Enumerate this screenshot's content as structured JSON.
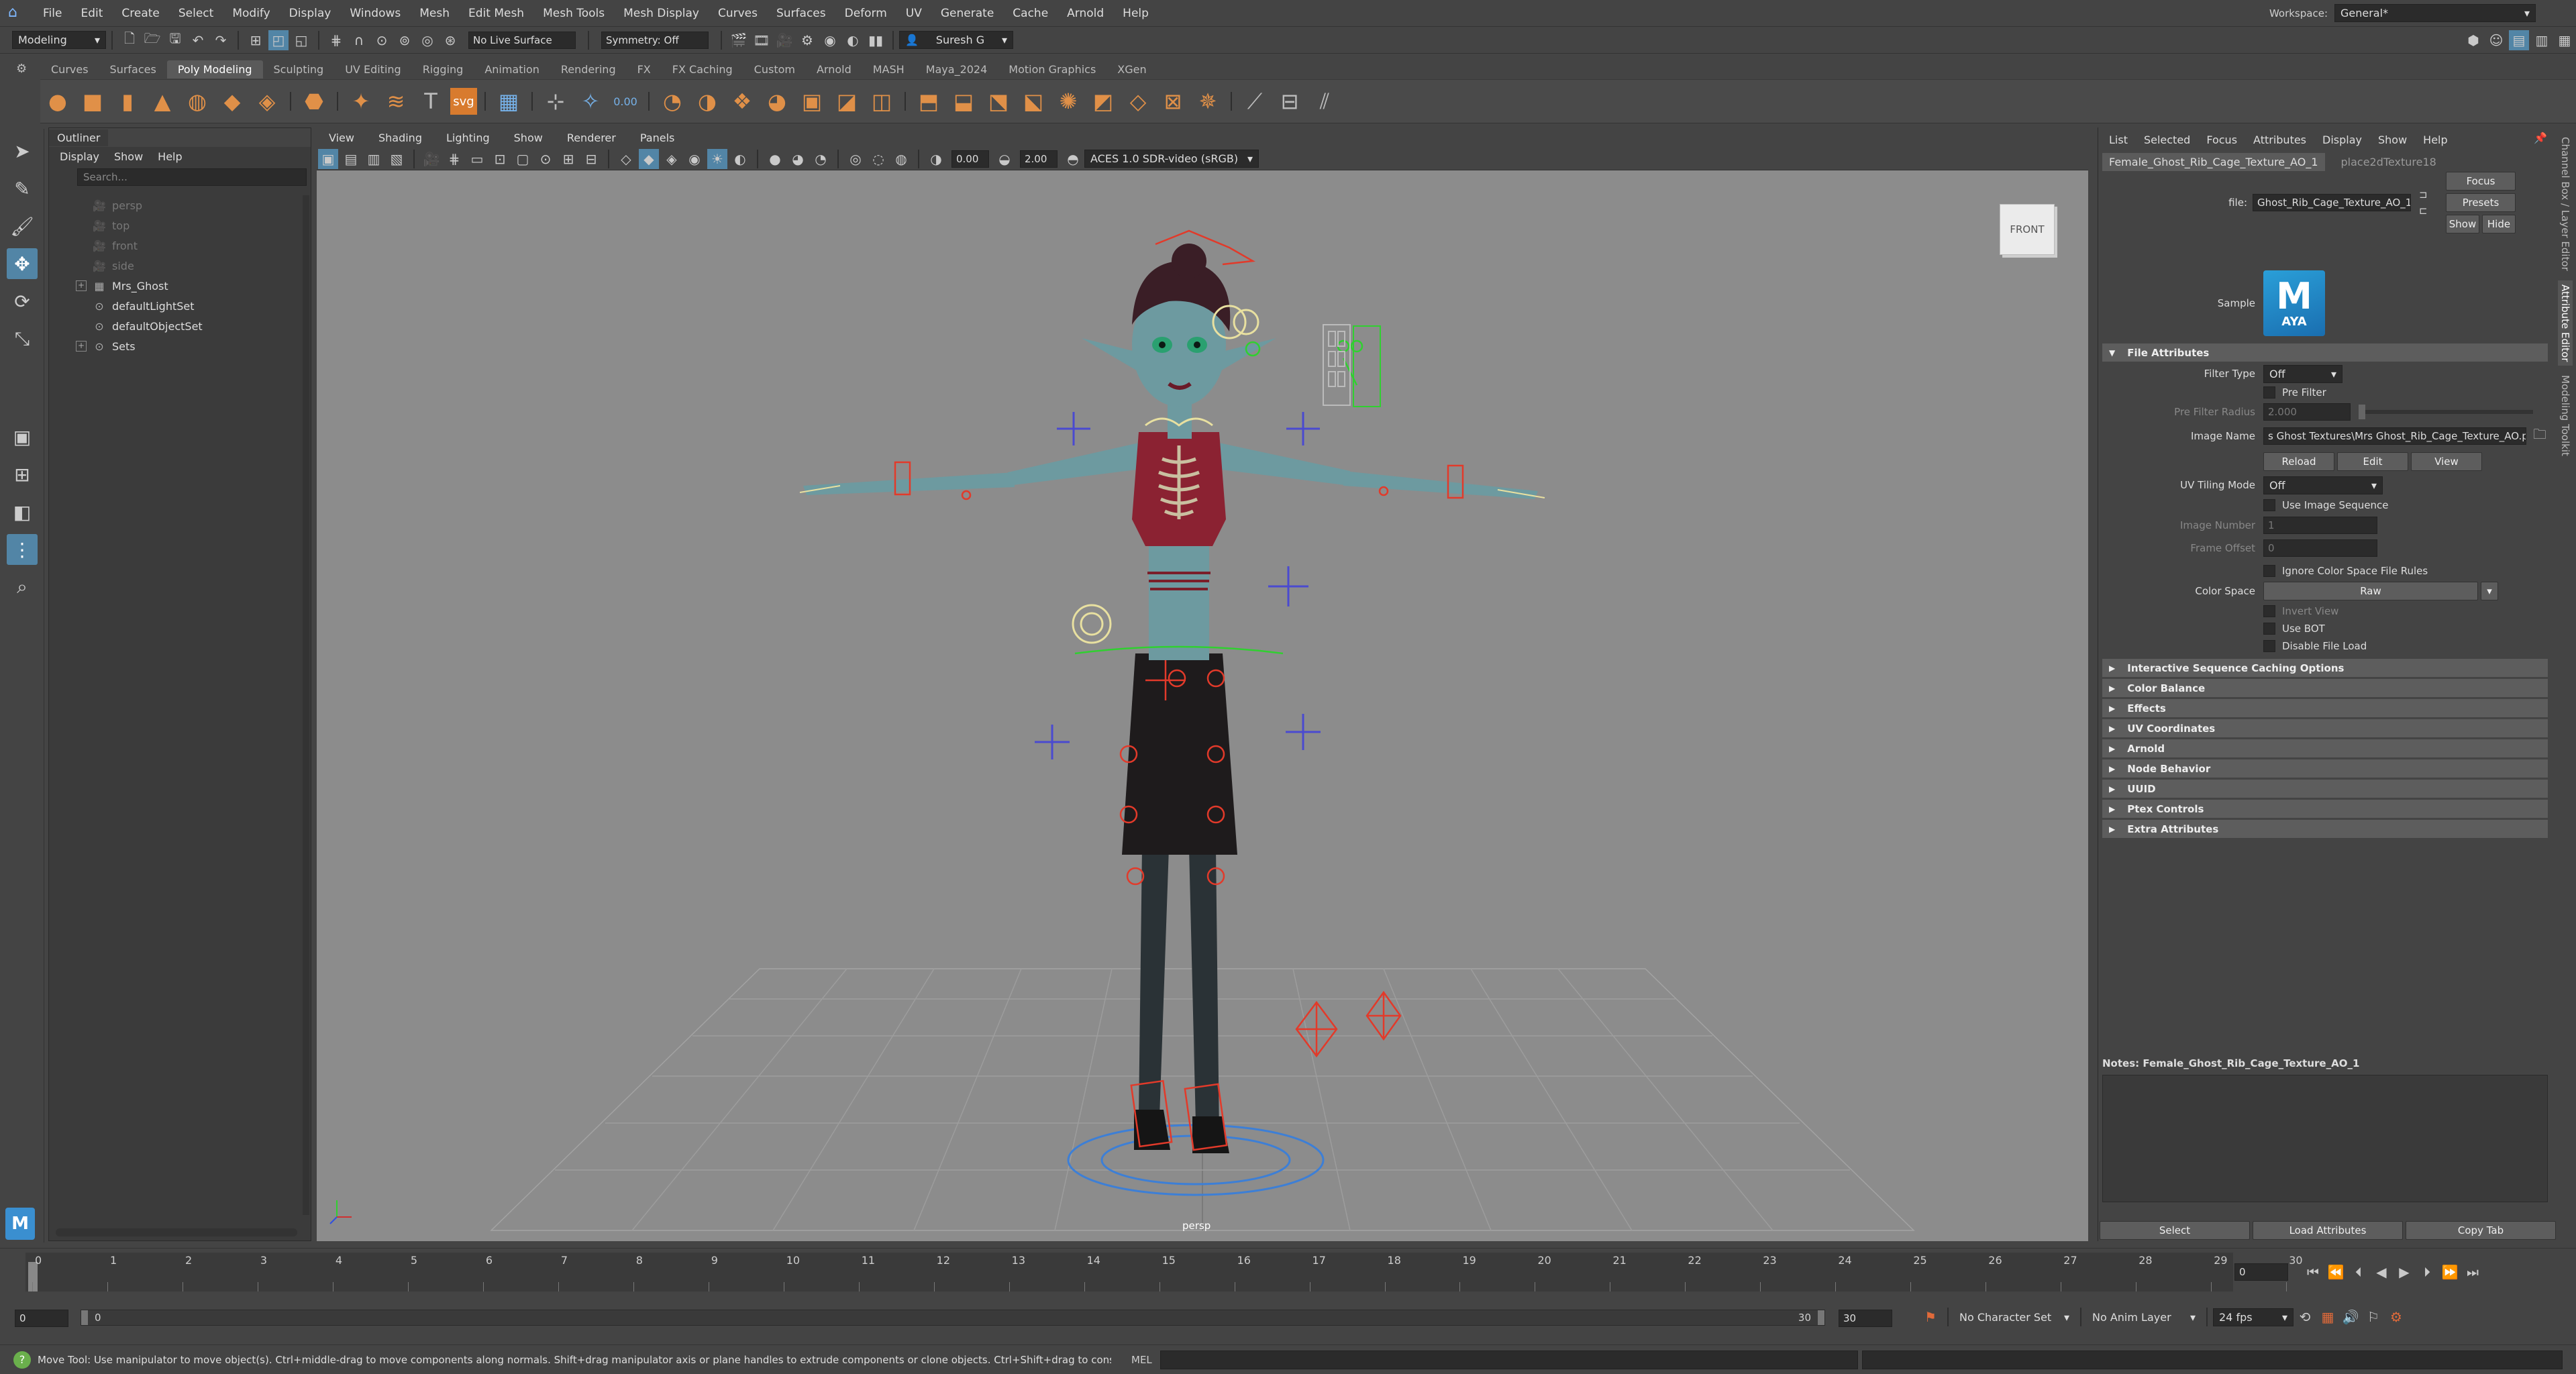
{
  "menubar": {
    "items": [
      "File",
      "Edit",
      "Create",
      "Select",
      "Modify",
      "Display",
      "Windows",
      "Mesh",
      "Edit Mesh",
      "Mesh Tools",
      "Mesh Display",
      "Curves",
      "Surfaces",
      "Deform",
      "UV",
      "Generate",
      "Cache",
      "Arnold",
      "Help"
    ],
    "workspace_label": "Workspace:",
    "workspace_value": "General*"
  },
  "statusline": {
    "mode": "Modeling",
    "live_surface": "No Live Surface",
    "symmetry": "Symmetry: Off",
    "user": "Suresh G"
  },
  "shelf": {
    "tabs": [
      "Curves",
      "Surfaces",
      "Poly Modeling",
      "Sculpting",
      "UV Editing",
      "Rigging",
      "Animation",
      "Rendering",
      "FX",
      "FX Caching",
      "Custom",
      "Arnold",
      "MASH",
      "Maya_2024",
      "Motion Graphics",
      "XGen"
    ],
    "active_tab": "Poly Modeling",
    "svg_label": "svg",
    "value_label": "0.00"
  },
  "outliner": {
    "title": "Outliner",
    "menu": [
      "Display",
      "Show",
      "Help"
    ],
    "search_placeholder": "Search...",
    "items": [
      {
        "label": "persp",
        "dim": true,
        "icon": "camera-icon"
      },
      {
        "label": "top",
        "dim": true,
        "icon": "camera-icon"
      },
      {
        "label": "front",
        "dim": true,
        "icon": "camera-icon"
      },
      {
        "label": "side",
        "dim": true,
        "icon": "camera-icon"
      },
      {
        "label": "Mrs_Ghost",
        "dim": false,
        "icon": "group-icon",
        "expandable": true
      },
      {
        "label": "defaultLightSet",
        "dim": false,
        "icon": "set-icon"
      },
      {
        "label": "defaultObjectSet",
        "dim": false,
        "icon": "set-icon"
      },
      {
        "label": "Sets",
        "dim": false,
        "icon": "set-icon",
        "expandable": true
      }
    ]
  },
  "viewport": {
    "menu": [
      "View",
      "Shading",
      "Lighting",
      "Show",
      "Renderer",
      "Panels"
    ],
    "exposure": "0.00",
    "gamma": "2.00",
    "color_transform": "ACES 1.0 SDR-video (sRGB)",
    "viewcube_label": "FRONT",
    "camera_label": "persp"
  },
  "attribute_editor": {
    "menu": [
      "List",
      "Selected",
      "Focus",
      "Attributes",
      "Display",
      "Show",
      "Help"
    ],
    "tabs": [
      "Female_Ghost_Rib_Cage_Texture_AO_1",
      "place2dTexture18"
    ],
    "file_label": "file:",
    "file_value": "Ghost_Rib_Cage_Texture_AO_1",
    "focus_button": "Focus",
    "presets_button": "Presets",
    "show_button": "Show",
    "hide_button": "Hide",
    "sample_label": "Sample",
    "sample_logo_letter": "M",
    "sample_logo_text": "AYA",
    "file_attributes_section": "File Attributes",
    "filter_type_label": "Filter Type",
    "filter_type_value": "Off",
    "pre_filter_label": "Pre Filter",
    "pre_filter_radius_label": "Pre Filter Radius",
    "pre_filter_radius_value": "2.000",
    "image_name_label": "Image Name",
    "image_name_value": "s Ghost Textures\\Mrs Ghost_Rib_Cage_Texture_AO.png",
    "reload_button": "Reload",
    "edit_button": "Edit",
    "view_button": "View",
    "uv_tiling_label": "UV Tiling Mode",
    "uv_tiling_value": "Off",
    "use_image_sequence": "Use Image Sequence",
    "image_number_label": "Image Number",
    "image_number_value": "1",
    "frame_offset_label": "Frame Offset",
    "frame_offset_value": "0",
    "ignore_color_space": "Ignore Color Space File Rules",
    "color_space_label": "Color Space",
    "color_space_value": "Raw",
    "invert_view": "Invert View",
    "use_bot": "Use BOT",
    "disable_file_load": "Disable File Load",
    "sections": [
      "Interactive Sequence Caching Options",
      "Color Balance",
      "Effects",
      "UV Coordinates",
      "Arnold",
      "Node Behavior",
      "UUID",
      "Ptex Controls",
      "Extra Attributes"
    ],
    "notes_label": "Notes: Female_Ghost_Rib_Cage_Texture_AO_1",
    "bottom_buttons": [
      "Select",
      "Load Attributes",
      "Copy Tab"
    ]
  },
  "side_tabs": [
    "Channel Box / Layer Editor",
    "Attribute Editor",
    "Modeling Toolkit"
  ],
  "timeline": {
    "ticks": [
      "0",
      "1",
      "2",
      "3",
      "4",
      "5",
      "6",
      "7",
      "8",
      "9",
      "10",
      "11",
      "12",
      "13",
      "14",
      "15",
      "16",
      "17",
      "18",
      "19",
      "20",
      "21",
      "22",
      "23",
      "24",
      "25",
      "26",
      "27",
      "28",
      "29",
      "30"
    ],
    "current_frame": "0"
  },
  "range": {
    "start": "0",
    "inner_start": "0",
    "inner_end": "30",
    "end": "30",
    "character_set": "No Character Set",
    "anim_layer": "No Anim Layer",
    "fps": "24 fps"
  },
  "command": {
    "help_text": "Move Tool: Use manipulator to move object(s). Ctrl+middle-drag to move components along normals. Shift+drag manipulator axis or plane handles to extrude components or clone objects. Ctrl+Shift+drag to constrain movement to a co",
    "mel_label": "MEL"
  },
  "colors": {
    "accent": "#5285a6",
    "shelf_icon": "#e09048",
    "viewport_bg": "#8c8c8c",
    "rig_red": "#e23a2a",
    "rig_blue": "#4a4ad0"
  }
}
